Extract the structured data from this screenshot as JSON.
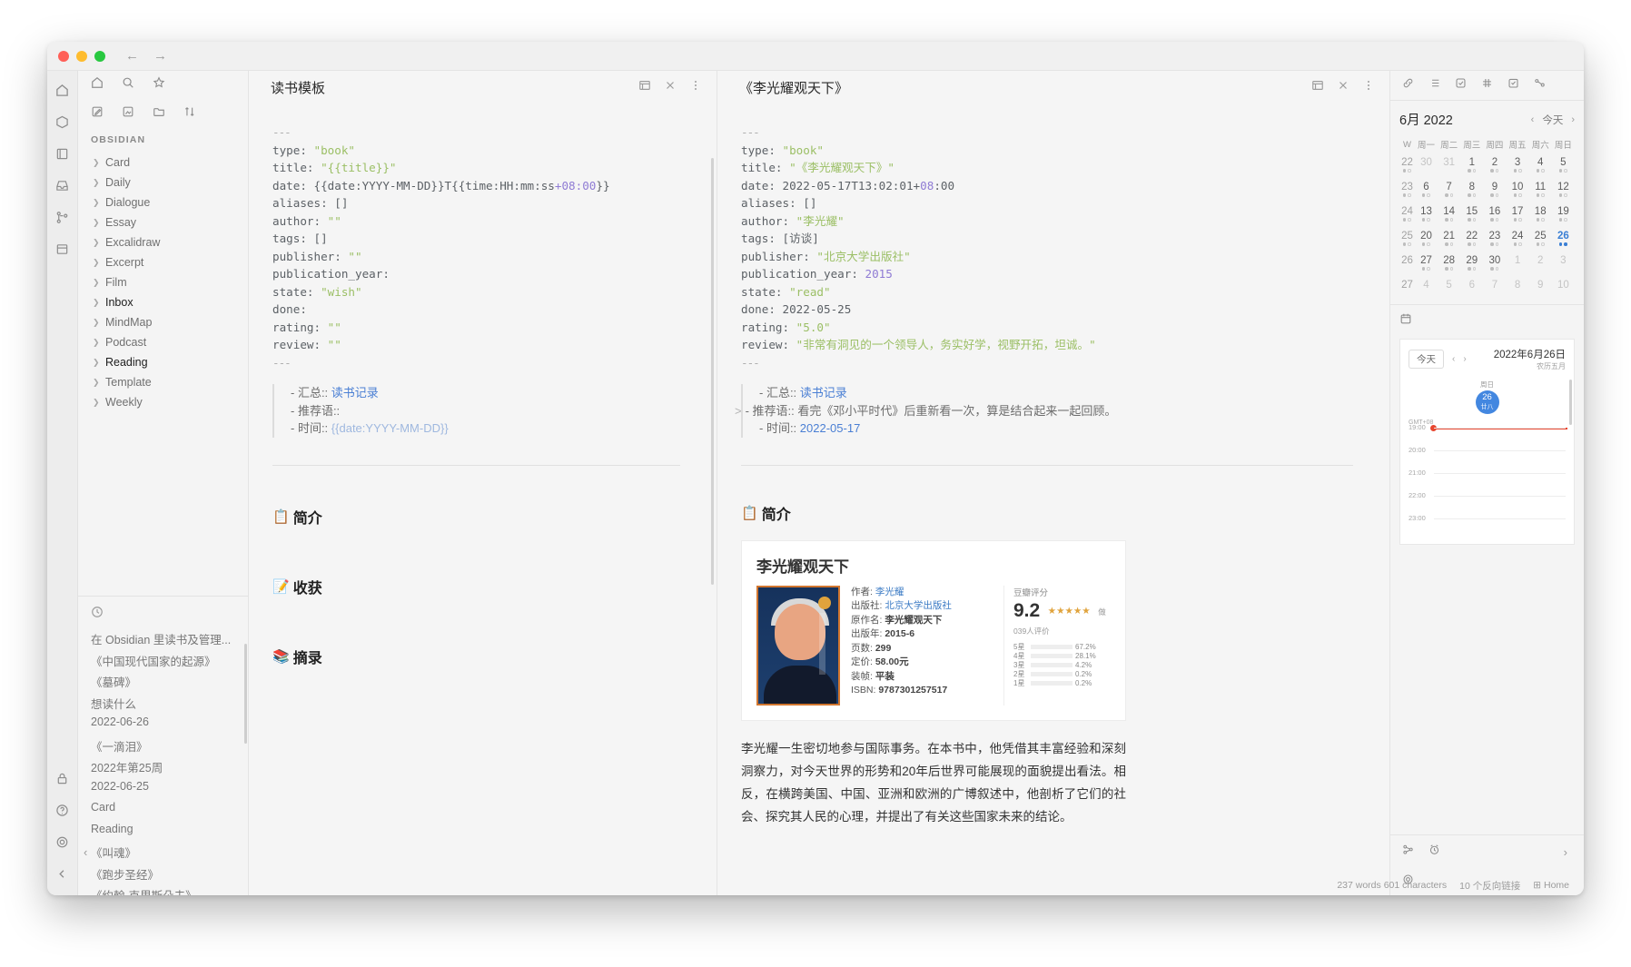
{
  "window": {
    "title": "Obsidian"
  },
  "sidebar": {
    "vault_label": "OBSIDIAN",
    "top_icons": [
      "home-icon",
      "search-icon",
      "star-icon"
    ],
    "tool_icons": [
      "new-note-icon",
      "new-canvas-icon",
      "new-folder-icon",
      "sort-icon"
    ],
    "items": [
      {
        "label": "Card"
      },
      {
        "label": "Daily"
      },
      {
        "label": "Dialogue"
      },
      {
        "label": "Essay"
      },
      {
        "label": "Excalidraw"
      },
      {
        "label": "Excerpt"
      },
      {
        "label": "Film"
      },
      {
        "label": "Inbox"
      },
      {
        "label": "MindMap"
      },
      {
        "label": "Podcast"
      },
      {
        "label": "Reading"
      },
      {
        "label": "Template"
      },
      {
        "label": "Weekly"
      }
    ],
    "active_items": [
      "Inbox",
      "Reading"
    ],
    "recent": [
      "在 Obsidian 里读书及管理...",
      "《中国现代国家的起源》",
      "《墓碑》",
      "想读什么",
      "2022-06-26",
      "《一滴泪》",
      "2022年第25周",
      "2022-06-25",
      "Card",
      "Reading",
      "《叫魂》",
      "《跑步圣经》",
      "《约翰·克里斯朵夫》"
    ]
  },
  "pane1": {
    "title": "读书模板",
    "frontmatter": [
      {
        "text": "---",
        "cls": "dash"
      },
      {
        "key": "type: ",
        "val": "\"book\"",
        "vcls": "str"
      },
      {
        "key": "title: ",
        "val": "\"{{title}}\"",
        "vcls": "str"
      },
      {
        "key": "date: {{date:YYYY-MM-DD}}T{{time:HH:mm:ss",
        "val": "+08:00",
        "vcls": "num",
        "tail": "}}"
      },
      {
        "key": "aliases: []",
        "val": ""
      },
      {
        "key": "author: ",
        "val": "\"\"",
        "vcls": "str"
      },
      {
        "key": "tags: []",
        "val": ""
      },
      {
        "key": "publisher: ",
        "val": "\"\"",
        "vcls": "str"
      },
      {
        "key": "publication_year:",
        "val": ""
      },
      {
        "key": "state: ",
        "val": "\"wish\"",
        "vcls": "str"
      },
      {
        "key": "done:",
        "val": ""
      },
      {
        "key": "rating: ",
        "val": "\"\"",
        "vcls": "str"
      },
      {
        "key": "review: ",
        "val": "\"\"",
        "vcls": "str"
      },
      {
        "text": "---",
        "cls": "dash"
      }
    ],
    "callout": {
      "line1_label": "- 汇总::",
      "line1_link": "读书记录",
      "line2": "- 推荐语::",
      "line3_label": "- 时间::",
      "line3_tmpl": "{{date:YYYY-MM-DD}}"
    },
    "sections": [
      {
        "emoji": "📋",
        "text": "简介"
      },
      {
        "emoji": "📝",
        "text": "收获"
      },
      {
        "emoji": "📚",
        "text": "摘录"
      }
    ]
  },
  "pane2": {
    "title": "《李光耀观天下》",
    "frontmatter": [
      {
        "text": "---",
        "cls": "dash"
      },
      {
        "key": "type: ",
        "val": "\"book\"",
        "vcls": "str"
      },
      {
        "key": "title: ",
        "val": "\"《李光耀观天下》\"",
        "vcls": "str"
      },
      {
        "key": "date: 2022-05-17T13:02:01+",
        "val": "08",
        "vcls": "num",
        "tail": ":00"
      },
      {
        "key": "aliases: []",
        "val": ""
      },
      {
        "key": "author: ",
        "val": "\"李光耀\"",
        "vcls": "str"
      },
      {
        "key": "tags: [访谈]",
        "val": ""
      },
      {
        "key": "publisher: ",
        "val": "\"北京大学出版社\"",
        "vcls": "str"
      },
      {
        "key": "publication_year: ",
        "val": "2015",
        "vcls": "num"
      },
      {
        "key": "state: ",
        "val": "\"read\"",
        "vcls": "str"
      },
      {
        "key": "done: 2022-05-25",
        "val": ""
      },
      {
        "key": "rating: ",
        "val": "\"5.0\"",
        "vcls": "str"
      },
      {
        "key": "review: ",
        "val": "\"非常有洞见的一个领导人，务实好学，视野开拓，坦诚。\"",
        "vcls": "str"
      },
      {
        "text": "---",
        "cls": "dash"
      }
    ],
    "callout": {
      "line1_label": "- 汇总::",
      "line1_link": "读书记录",
      "fold_marker": ">",
      "line2": "- 推荐语:: 看完《邓小平时代》后重新看一次，算是结合起来一起回顾。",
      "line3_label": "- 时间::",
      "line3_value": "2022-05-17"
    },
    "section_intro": {
      "emoji": "📋",
      "text": "简介"
    },
    "book_card": {
      "title": "李光耀观天下",
      "fields": [
        {
          "k": "作者: ",
          "v": "李光耀",
          "link": true
        },
        {
          "k": "出版社: ",
          "v": "北京大学出版社",
          "link": true
        },
        {
          "k": "原作名: ",
          "v": "李光耀观天下",
          "link": false
        },
        {
          "k": "出版年: ",
          "v": "2015-6",
          "link": false
        },
        {
          "k": "页数: ",
          "v": "299",
          "link": false
        },
        {
          "k": "定价: ",
          "v": "58.00元",
          "link": false
        },
        {
          "k": "装帧: ",
          "v": "平装",
          "link": false
        },
        {
          "k": "ISBN: ",
          "v": "9787301257517",
          "link": false
        }
      ],
      "rating_title": "豆瓣评分",
      "score": "9.2",
      "stars": "★★★★★",
      "rater_count": "做039人评价",
      "distribution": [
        {
          "label": "5星",
          "pct": 67.2,
          "text": "67.2%"
        },
        {
          "label": "4星",
          "pct": 28.1,
          "text": "28.1%"
        },
        {
          "label": "3星",
          "pct": 4.2,
          "text": "4.2%"
        },
        {
          "label": "2星",
          "pct": 0.2,
          "text": "0.2%"
        },
        {
          "label": "1星",
          "pct": 0.2,
          "text": "0.2%"
        }
      ]
    },
    "paragraph": "李光耀一生密切地参与国际事务。在本书中，他凭借其丰富经验和深刻洞察力，对今天世界的形势和20年后世界可能展现的面貌提出看法。相反，在横跨美国、中国、亚洲和欧洲的广博叙述中，他剖析了它们的社会、探究其人民的心理，并提出了有关这些国家未来的结论。"
  },
  "right_panel": {
    "tool_icons": [
      "link-icon",
      "list-icon",
      "tasks-icon",
      "tag-icon",
      "checklist-icon",
      "graph-icon"
    ],
    "calendar": {
      "month_label": "6月 2022",
      "today_label": "今天",
      "week_header": "W",
      "day_headers": [
        "周一",
        "周二",
        "周三",
        "周四",
        "周五",
        "周六",
        "周日"
      ],
      "weeks": [
        {
          "w": "22",
          "days": [
            {
              "d": "30",
              "dim": true
            },
            {
              "d": "31",
              "dim": true
            },
            {
              "d": "1"
            },
            {
              "d": "2"
            },
            {
              "d": "3"
            },
            {
              "d": "4"
            },
            {
              "d": "5"
            }
          ]
        },
        {
          "w": "23",
          "days": [
            {
              "d": "6"
            },
            {
              "d": "7"
            },
            {
              "d": "8"
            },
            {
              "d": "9"
            },
            {
              "d": "10"
            },
            {
              "d": "11"
            },
            {
              "d": "12"
            }
          ]
        },
        {
          "w": "24",
          "days": [
            {
              "d": "13"
            },
            {
              "d": "14"
            },
            {
              "d": "15"
            },
            {
              "d": "16"
            },
            {
              "d": "17"
            },
            {
              "d": "18"
            },
            {
              "d": "19"
            }
          ]
        },
        {
          "w": "25",
          "days": [
            {
              "d": "20"
            },
            {
              "d": "21"
            },
            {
              "d": "22"
            },
            {
              "d": "23"
            },
            {
              "d": "24"
            },
            {
              "d": "25"
            },
            {
              "d": "26",
              "sel": true
            }
          ]
        },
        {
          "w": "26",
          "days": [
            {
              "d": "27"
            },
            {
              "d": "28"
            },
            {
              "d": "29"
            },
            {
              "d": "30"
            },
            {
              "d": "1",
              "dim": true
            },
            {
              "d": "2",
              "dim": true
            },
            {
              "d": "3",
              "dim": true
            }
          ]
        },
        {
          "w": "27",
          "days": [
            {
              "d": "4",
              "dim": true
            },
            {
              "d": "5",
              "dim": true
            },
            {
              "d": "6",
              "dim": true
            },
            {
              "d": "7",
              "dim": true
            },
            {
              "d": "8",
              "dim": true
            },
            {
              "d": "9",
              "dim": true
            },
            {
              "d": "10",
              "dim": true
            }
          ]
        }
      ]
    },
    "timeline": {
      "today_button": "今天",
      "date_main": "2022年6月26日",
      "date_sub": "农历五月",
      "day_of_week": "周日",
      "day_num": "26",
      "day_lunar": "廿八",
      "gmt_label": "GMT+08",
      "hours": [
        "19:00",
        "20:00",
        "21:00",
        "22:00",
        "23:00"
      ]
    },
    "footer_icons": [
      "graph-icon",
      "clock-icon"
    ],
    "gear_icon": "gear-icon"
  },
  "status_bar": {
    "words": "237 words 601 characters",
    "backlinks": "10 个反向链接",
    "home": "Home"
  }
}
